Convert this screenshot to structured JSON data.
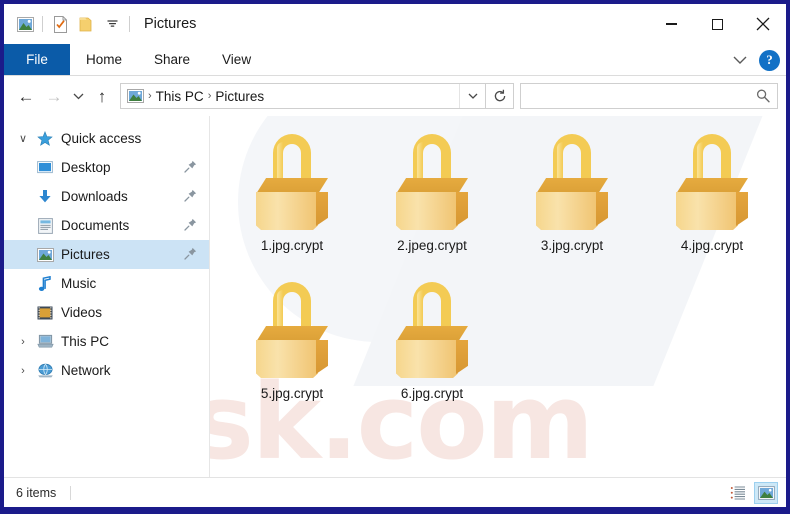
{
  "window": {
    "title": "Pictures",
    "border_color": "#1b1b8a",
    "quick_access_toolbar": [
      {
        "icon": "picture-folder-icon",
        "name": "window-menu-icon"
      },
      {
        "icon": "properties-icon",
        "name": "properties-button"
      },
      {
        "icon": "new-folder-icon",
        "name": "new-folder-button"
      },
      {
        "icon": "chevron-down-icon",
        "name": "customize-qat-button"
      }
    ],
    "controls": {
      "minimize": "minimize-button",
      "maximize": "maximize-button",
      "close_label": "✕"
    }
  },
  "ribbon": {
    "tabs": [
      {
        "label": "File",
        "active": true
      },
      {
        "label": "Home",
        "active": false
      },
      {
        "label": "Share",
        "active": false
      },
      {
        "label": "View",
        "active": false
      }
    ],
    "expand_icon": "chevron-down-icon",
    "help_label": "?",
    "file_tab_color": "#0b5ba8"
  },
  "address_bar": {
    "back": "←",
    "forward": "→",
    "recent": "∨",
    "up": "↑",
    "breadcrumb": [
      {
        "label": "This PC"
      },
      {
        "label": "Pictures"
      }
    ],
    "separator": "›",
    "dropdown_icon": "chevron-down-icon",
    "refresh_icon": "refresh-icon",
    "location_icon": "pictures-icon"
  },
  "search": {
    "value": "",
    "placeholder": "",
    "icon": "search-icon"
  },
  "sidebar": {
    "items": [
      {
        "label": "Quick access",
        "icon": "star-icon",
        "indent": 0,
        "expander": "∨",
        "pinned": false,
        "selected": false
      },
      {
        "label": "Desktop",
        "icon": "desktop-icon",
        "indent": 1,
        "expander": "",
        "pinned": true,
        "selected": false
      },
      {
        "label": "Downloads",
        "icon": "downloads-icon",
        "indent": 1,
        "expander": "",
        "pinned": true,
        "selected": false
      },
      {
        "label": "Documents",
        "icon": "documents-icon",
        "indent": 1,
        "expander": "",
        "pinned": true,
        "selected": false
      },
      {
        "label": "Pictures",
        "icon": "pictures-icon",
        "indent": 1,
        "expander": "",
        "pinned": true,
        "selected": true
      },
      {
        "label": "Music",
        "icon": "music-icon",
        "indent": 1,
        "expander": "",
        "pinned": false,
        "selected": false
      },
      {
        "label": "Videos",
        "icon": "videos-icon",
        "indent": 1,
        "expander": "",
        "pinned": false,
        "selected": false
      },
      {
        "label": "This PC",
        "icon": "thispc-icon",
        "indent": 0,
        "expander": "›",
        "pinned": false,
        "selected": false
      },
      {
        "label": "Network",
        "icon": "network-icon",
        "indent": 0,
        "expander": "›",
        "pinned": false,
        "selected": false
      }
    ],
    "selection_color": "#cce3f5"
  },
  "files": [
    {
      "name": "1.jpg.crypt",
      "icon": "padlock-icon"
    },
    {
      "name": "2.jpeg.crypt",
      "icon": "padlock-icon"
    },
    {
      "name": "3.jpg.crypt",
      "icon": "padlock-icon"
    },
    {
      "name": "4.jpg.crypt",
      "icon": "padlock-icon"
    },
    {
      "name": "5.jpg.crypt",
      "icon": "padlock-icon"
    },
    {
      "name": "6.jpg.crypt",
      "icon": "padlock-icon"
    }
  ],
  "watermark": {
    "text": "sk.com"
  },
  "status_bar": {
    "item_count": "6 items",
    "views": [
      {
        "icon": "details-view-icon",
        "active": false
      },
      {
        "icon": "large-icons-view-icon",
        "active": true
      }
    ]
  }
}
